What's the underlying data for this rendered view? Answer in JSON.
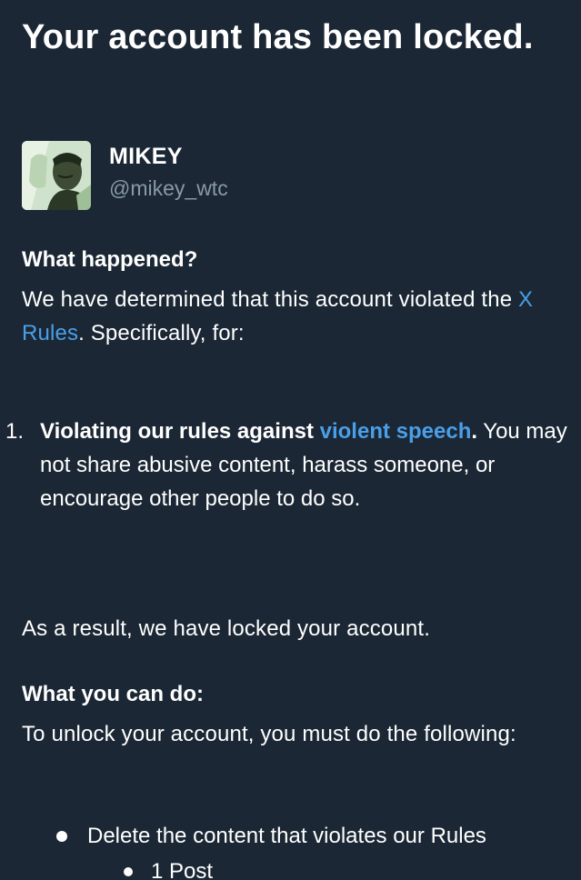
{
  "colors": {
    "background": "#1b2734",
    "text": "#ffffff",
    "muted": "#8899a6",
    "link": "#4a9fe8"
  },
  "header": {
    "title": "Your account has been locked."
  },
  "profile": {
    "display_name": "MIKEY",
    "handle": "@mikey_wtc",
    "avatar_icon": "profile-photo"
  },
  "what_happened": {
    "heading": "What happened?",
    "text_before": "We have determined that this account violated the ",
    "rules_link": "X Rules",
    "text_after": ". Specifically, for:"
  },
  "violations": [
    {
      "number": "1.",
      "bold_before": "Violating our rules against ",
      "link": "violent speech",
      "bold_after": ".",
      "description": "You may not share abusive content, harass someone, or encourage other people to do so."
    }
  ],
  "result": {
    "text": "As a result, we have locked your account."
  },
  "what_you_can_do": {
    "heading": "What you can do:",
    "text": "To unlock your account, you must do the following:",
    "steps": [
      {
        "label": "Delete the content that violates our Rules",
        "sub_items": [
          "1 Post"
        ]
      }
    ]
  }
}
